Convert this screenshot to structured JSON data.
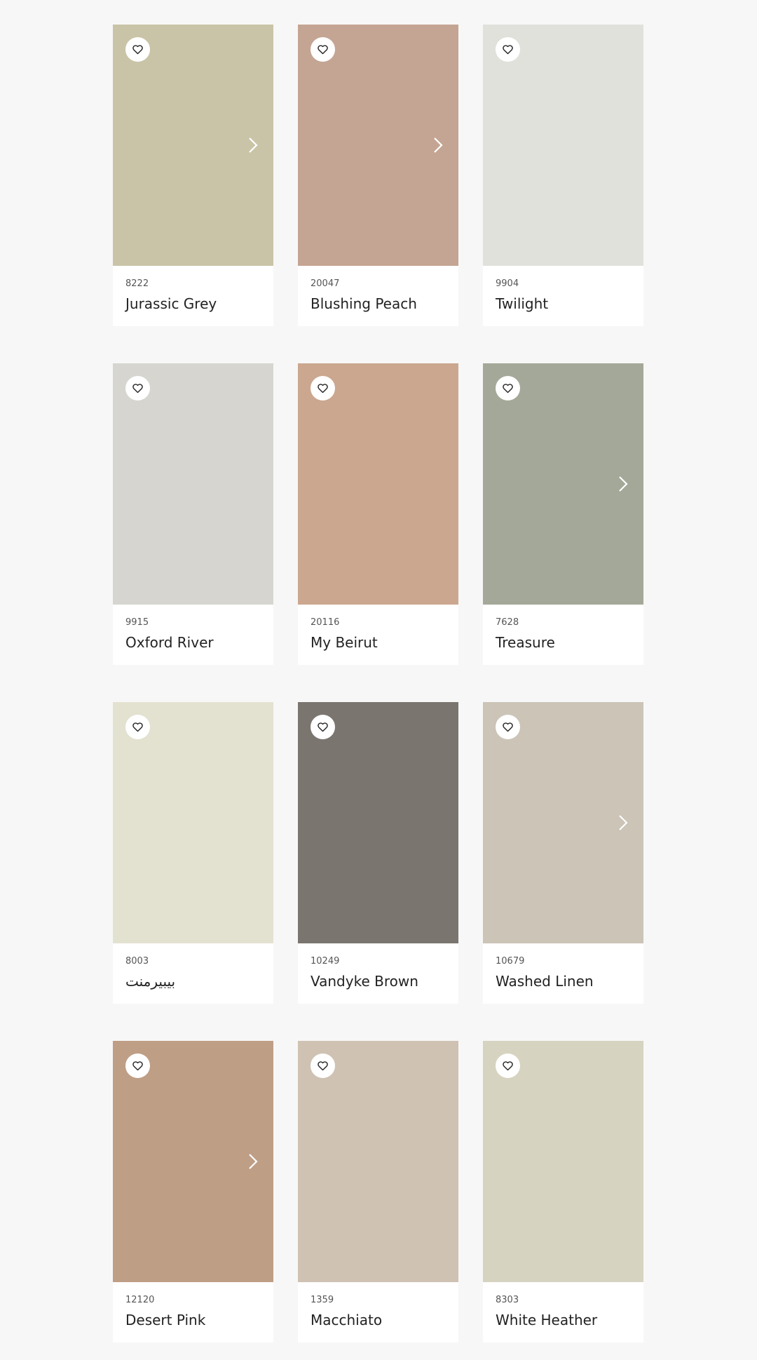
{
  "swatches": [
    {
      "code": "8222",
      "name": "Jurassic Grey",
      "color": "#c9c4a7",
      "has_next": true
    },
    {
      "code": "20047",
      "name": "Blushing Peach",
      "color": "#c4a593",
      "has_next": true
    },
    {
      "code": "9904",
      "name": "Twilight",
      "color": "#e1e1dc",
      "has_next": false
    },
    {
      "code": "9915",
      "name": "Oxford River",
      "color": "#d6d5d0",
      "has_next": false
    },
    {
      "code": "20116",
      "name": "My Beirut",
      "color": "#cba790",
      "has_next": false
    },
    {
      "code": "7628",
      "name": "Treasure",
      "color": "#a4a898",
      "has_next": true
    },
    {
      "code": "8003",
      "name": "بيبيرمنت",
      "color": "#e3e2d1",
      "has_next": false
    },
    {
      "code": "10249",
      "name": "Vandyke Brown",
      "color": "#7a756e",
      "has_next": false
    },
    {
      "code": "10679",
      "name": "Washed Linen",
      "color": "#cbc4b7",
      "has_next": true
    },
    {
      "code": "12120",
      "name": "Desert Pink",
      "color": "#bf9e86",
      "has_next": true
    },
    {
      "code": "1359",
      "name": "Macchiato",
      "color": "#cfc2b3",
      "has_next": false
    },
    {
      "code": "8303",
      "name": "White Heather",
      "color": "#d6d3c0",
      "has_next": false
    }
  ],
  "icons": {
    "favorite": "heart-outline-icon",
    "next": "chevron-right-icon"
  },
  "colors": {
    "page_background": "#f7f7f7",
    "card_background": "#ffffff",
    "code_text": "#555555",
    "name_text": "#222222"
  }
}
